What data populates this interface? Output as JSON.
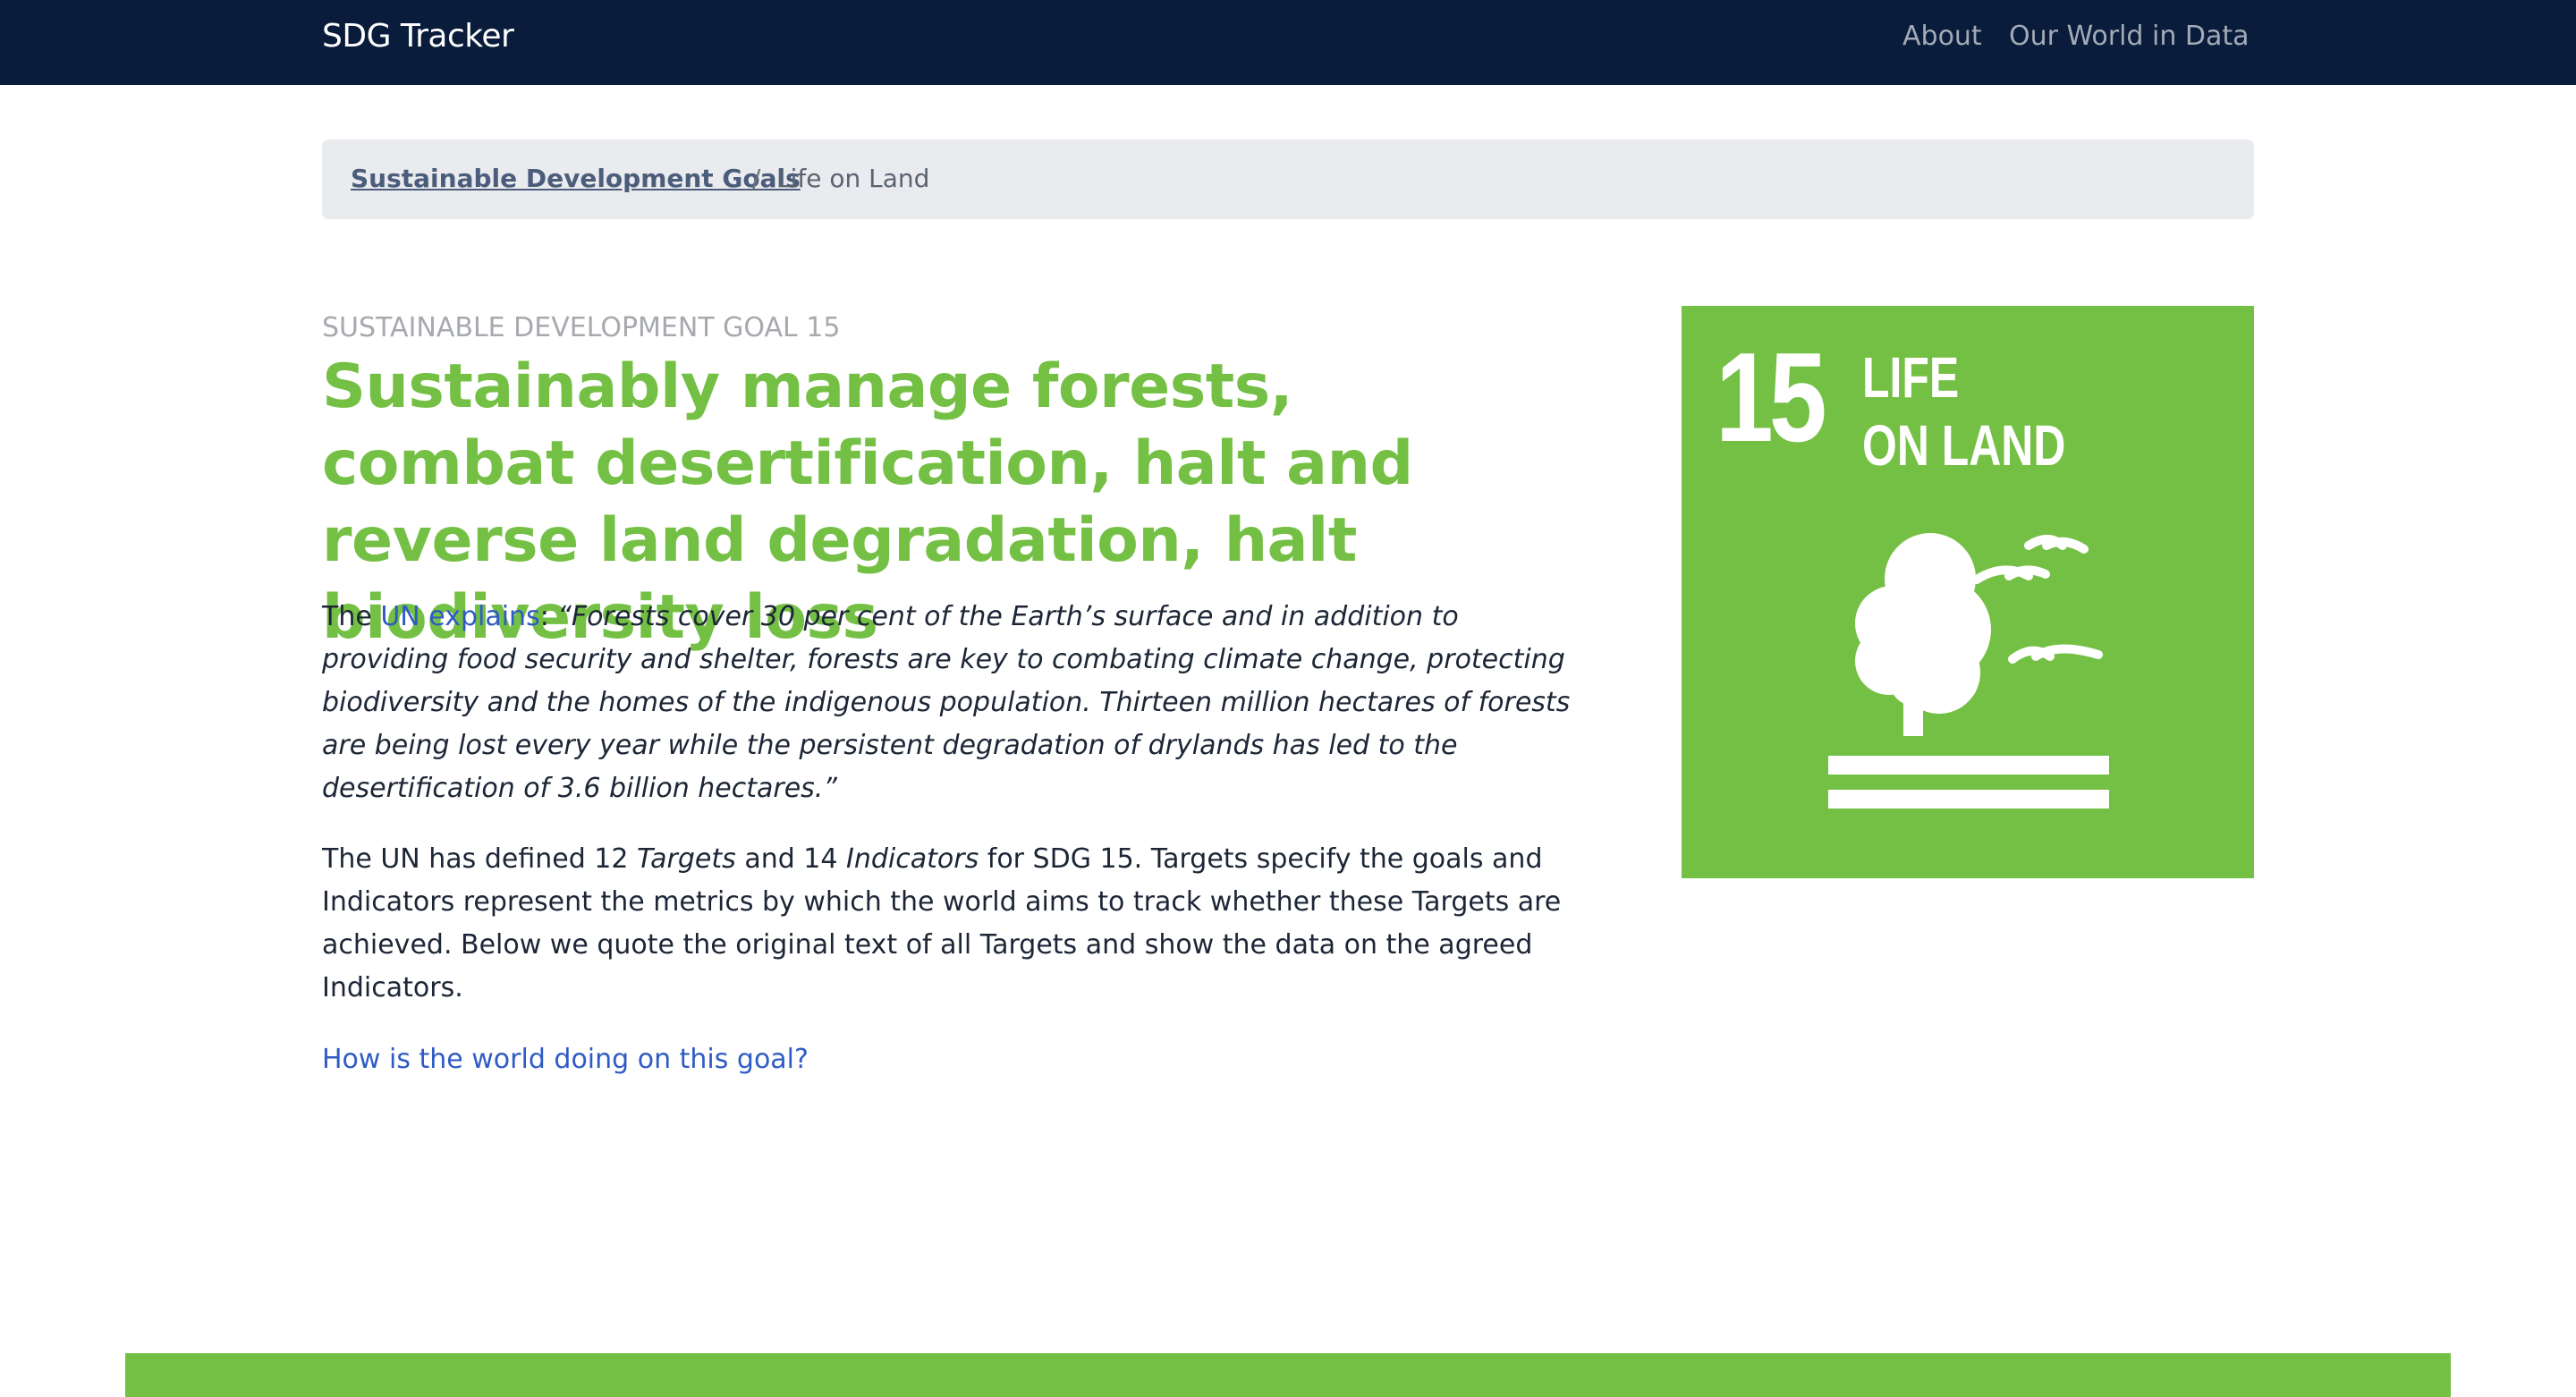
{
  "navbar": {
    "brand": "SDG Tracker",
    "links": [
      {
        "label": "About"
      },
      {
        "label": "Our World in Data"
      }
    ]
  },
  "breadcrumb": {
    "parent": "Sustainable Development Goals",
    "separator": "/",
    "current": "Life on Land"
  },
  "goal": {
    "eyebrow": "SUSTAINABLE DEVELOPMENT GOAL 15",
    "title": "Sustainably manage forests, combat desertification, halt and reverse land degradation, halt biodiversity loss",
    "intro_prefix": "The ",
    "intro_link": "UN explains",
    "intro_colon": ": ",
    "quote": "“Forests cover 30 per cent of the Earth’s surface and in addition to providing food security and shelter, forests are key to combating climate change, protecting biodiversity and the homes of the indigenous population. Thirteen million hectares of forests are being lost every year while the persistent degradation of drylands has led to the desertification of 3.6 billion hectares.”",
    "p2_a": "The UN has defined 12 ",
    "p2_targets": "Targets",
    "p2_b": " and 14 ",
    "p2_indicators": "Indicators",
    "p2_c": " for SDG 15. Targets specify the goals and Indicators represent the metrics by which the world aims to track whether these Targets are achieved. Below we quote the original text of all Targets and show the data on the agreed Indicators.",
    "progress_link": "How is the world doing on this goal?"
  },
  "tile": {
    "number": "15",
    "line1": "LIFE",
    "line2": "ON LAND",
    "color": "#74c044"
  },
  "colors": {
    "navbar": "#0a1c3b",
    "accent_green": "#74c044",
    "link_blue": "#2f5bc5"
  }
}
